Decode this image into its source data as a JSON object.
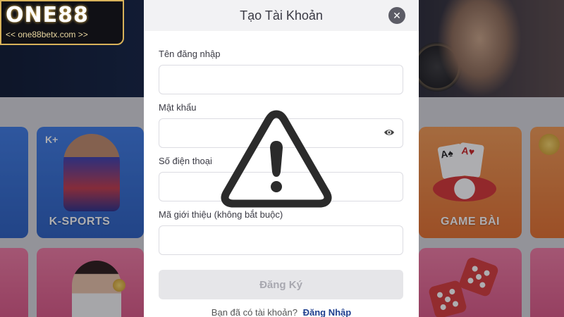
{
  "brand": {
    "name": "ONE88",
    "url": "<< one88betx.com >>"
  },
  "background": {
    "cards": [
      {
        "label": "K-SPORTS",
        "logo": "K+"
      },
      {
        "label": "GAME BÀI"
      }
    ]
  },
  "modal": {
    "title": "Tạo Tài Khoản",
    "close_icon": "close-icon",
    "fields": [
      {
        "label": "Tên đăng nhập",
        "value": "",
        "placeholder": ""
      },
      {
        "label": "Mật khẩu",
        "value": "",
        "placeholder": "",
        "icon": "eye-icon"
      },
      {
        "label": "Số điện thoại",
        "value": "",
        "placeholder": ""
      },
      {
        "label": "Mã giới thiệu (không bắt buộc)",
        "value": "",
        "placeholder": ""
      }
    ],
    "submit_label": "Đăng Ký",
    "footer_text": "Bạn đã có tài khoản?",
    "login_link": "Đăng Nhập"
  },
  "overlay_icon": "warning-icon",
  "colors": {
    "accent_gold": "#d8b25a",
    "link": "#1f3f8f",
    "button_disabled": "#e6e6e9"
  }
}
